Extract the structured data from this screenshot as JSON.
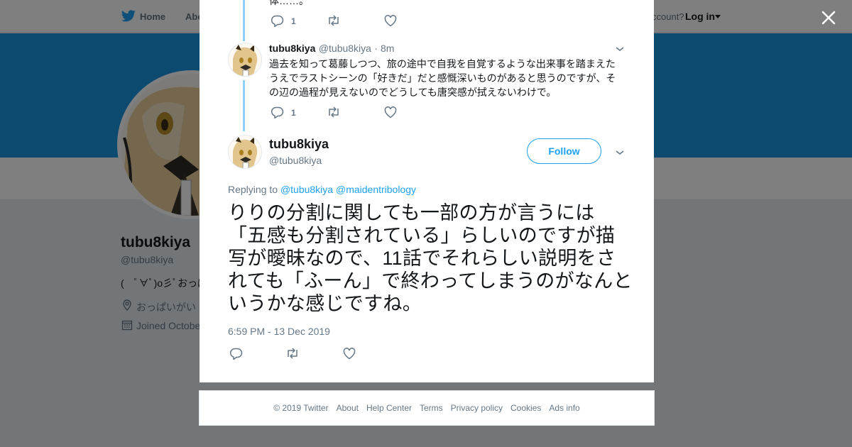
{
  "topbar": {
    "home_label": "Home",
    "about_label": "Abo",
    "account_prompt": "ccount?",
    "login_label": "Log in"
  },
  "profile": {
    "name": "tubu8kiya",
    "handle": "@tubu8kiya",
    "bio": "(　ﾟ∀ﾟ)o彡ﾟおっぱ",
    "location": "おっぱいがい",
    "joined": "Joined Octobe"
  },
  "thread": {
    "cut_text": "体……。",
    "prev_actions": {
      "reply_count": "1"
    },
    "reply": {
      "name": "tubu8kiya",
      "handle": "@tubu8kiya",
      "time": "· 8m",
      "text": "過去を知って葛藤しつつ、旅の途中で自我を自覚するような出来事を踏まえたうえでラストシーンの「好きだ」だと感慨深いものがあると思うのですが、その辺の過程が見えないのでどうしても唐突感が拭えないわけで。",
      "reply_count": "1"
    },
    "main": {
      "name": "tubu8kiya",
      "handle": "@tubu8kiya",
      "follow_label": "Follow",
      "replying_prefix": "Replying to ",
      "replying_to_1": "@tubu8kiya",
      "replying_to_2": "@maidentribology",
      "text": "りりの分割に関しても一部の方が言うには「五感も分割されている」らしいのですが描写が曖昧なので、11話でそれらしい説明をされても「ふーん」で終わってしまうのがなんというかな感じですね。",
      "timestamp": "6:59 PM - 13 Dec 2019"
    }
  },
  "footer": {
    "copyright": "© 2019 Twitter",
    "about": "About",
    "help": "Help Center",
    "terms": "Terms",
    "privacy": "Privacy policy",
    "cookies": "Cookies",
    "ads": "Ads info"
  },
  "colors": {
    "accent": "#1da1f2",
    "banner": "#1b95e0",
    "thread_line": "#8fd0f7",
    "muted": "#657786"
  },
  "icons": [
    "twitter-bird-icon",
    "reply-icon",
    "retweet-icon",
    "like-icon",
    "chevron-down-icon",
    "close-icon",
    "location-icon",
    "calendar-icon"
  ]
}
